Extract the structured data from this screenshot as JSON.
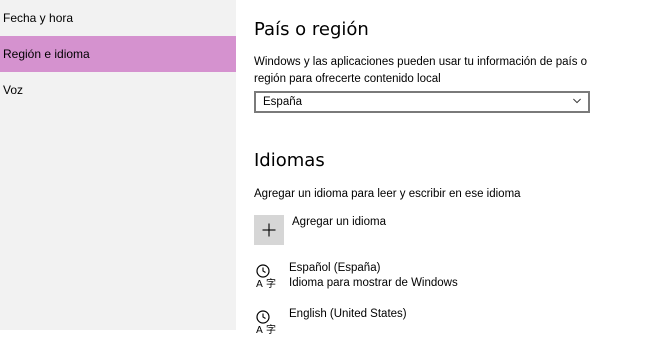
{
  "sidebar": {
    "items": [
      {
        "label": "Fecha y hora"
      },
      {
        "label": "Región e idioma"
      },
      {
        "label": "Voz"
      }
    ]
  },
  "region": {
    "title": "País o región",
    "description_line1": "Windows y las aplicaciones pueden usar tu información de país o",
    "description_line2": "región para ofrecerte contenido local",
    "selected": "España"
  },
  "languages": {
    "title": "Idiomas",
    "description": "Agregar un idioma para leer y escribir en ese idioma",
    "add_label": "Agregar un idioma",
    "items": [
      {
        "name": "Español (España)",
        "sub": "Idioma para mostrar de Windows"
      },
      {
        "name": "English (United States)",
        "sub": ""
      }
    ]
  },
  "colors": {
    "accent": "#d592cf",
    "sidebar_bg": "#f2f2f2",
    "add_button_bg": "#d6d6d6"
  }
}
